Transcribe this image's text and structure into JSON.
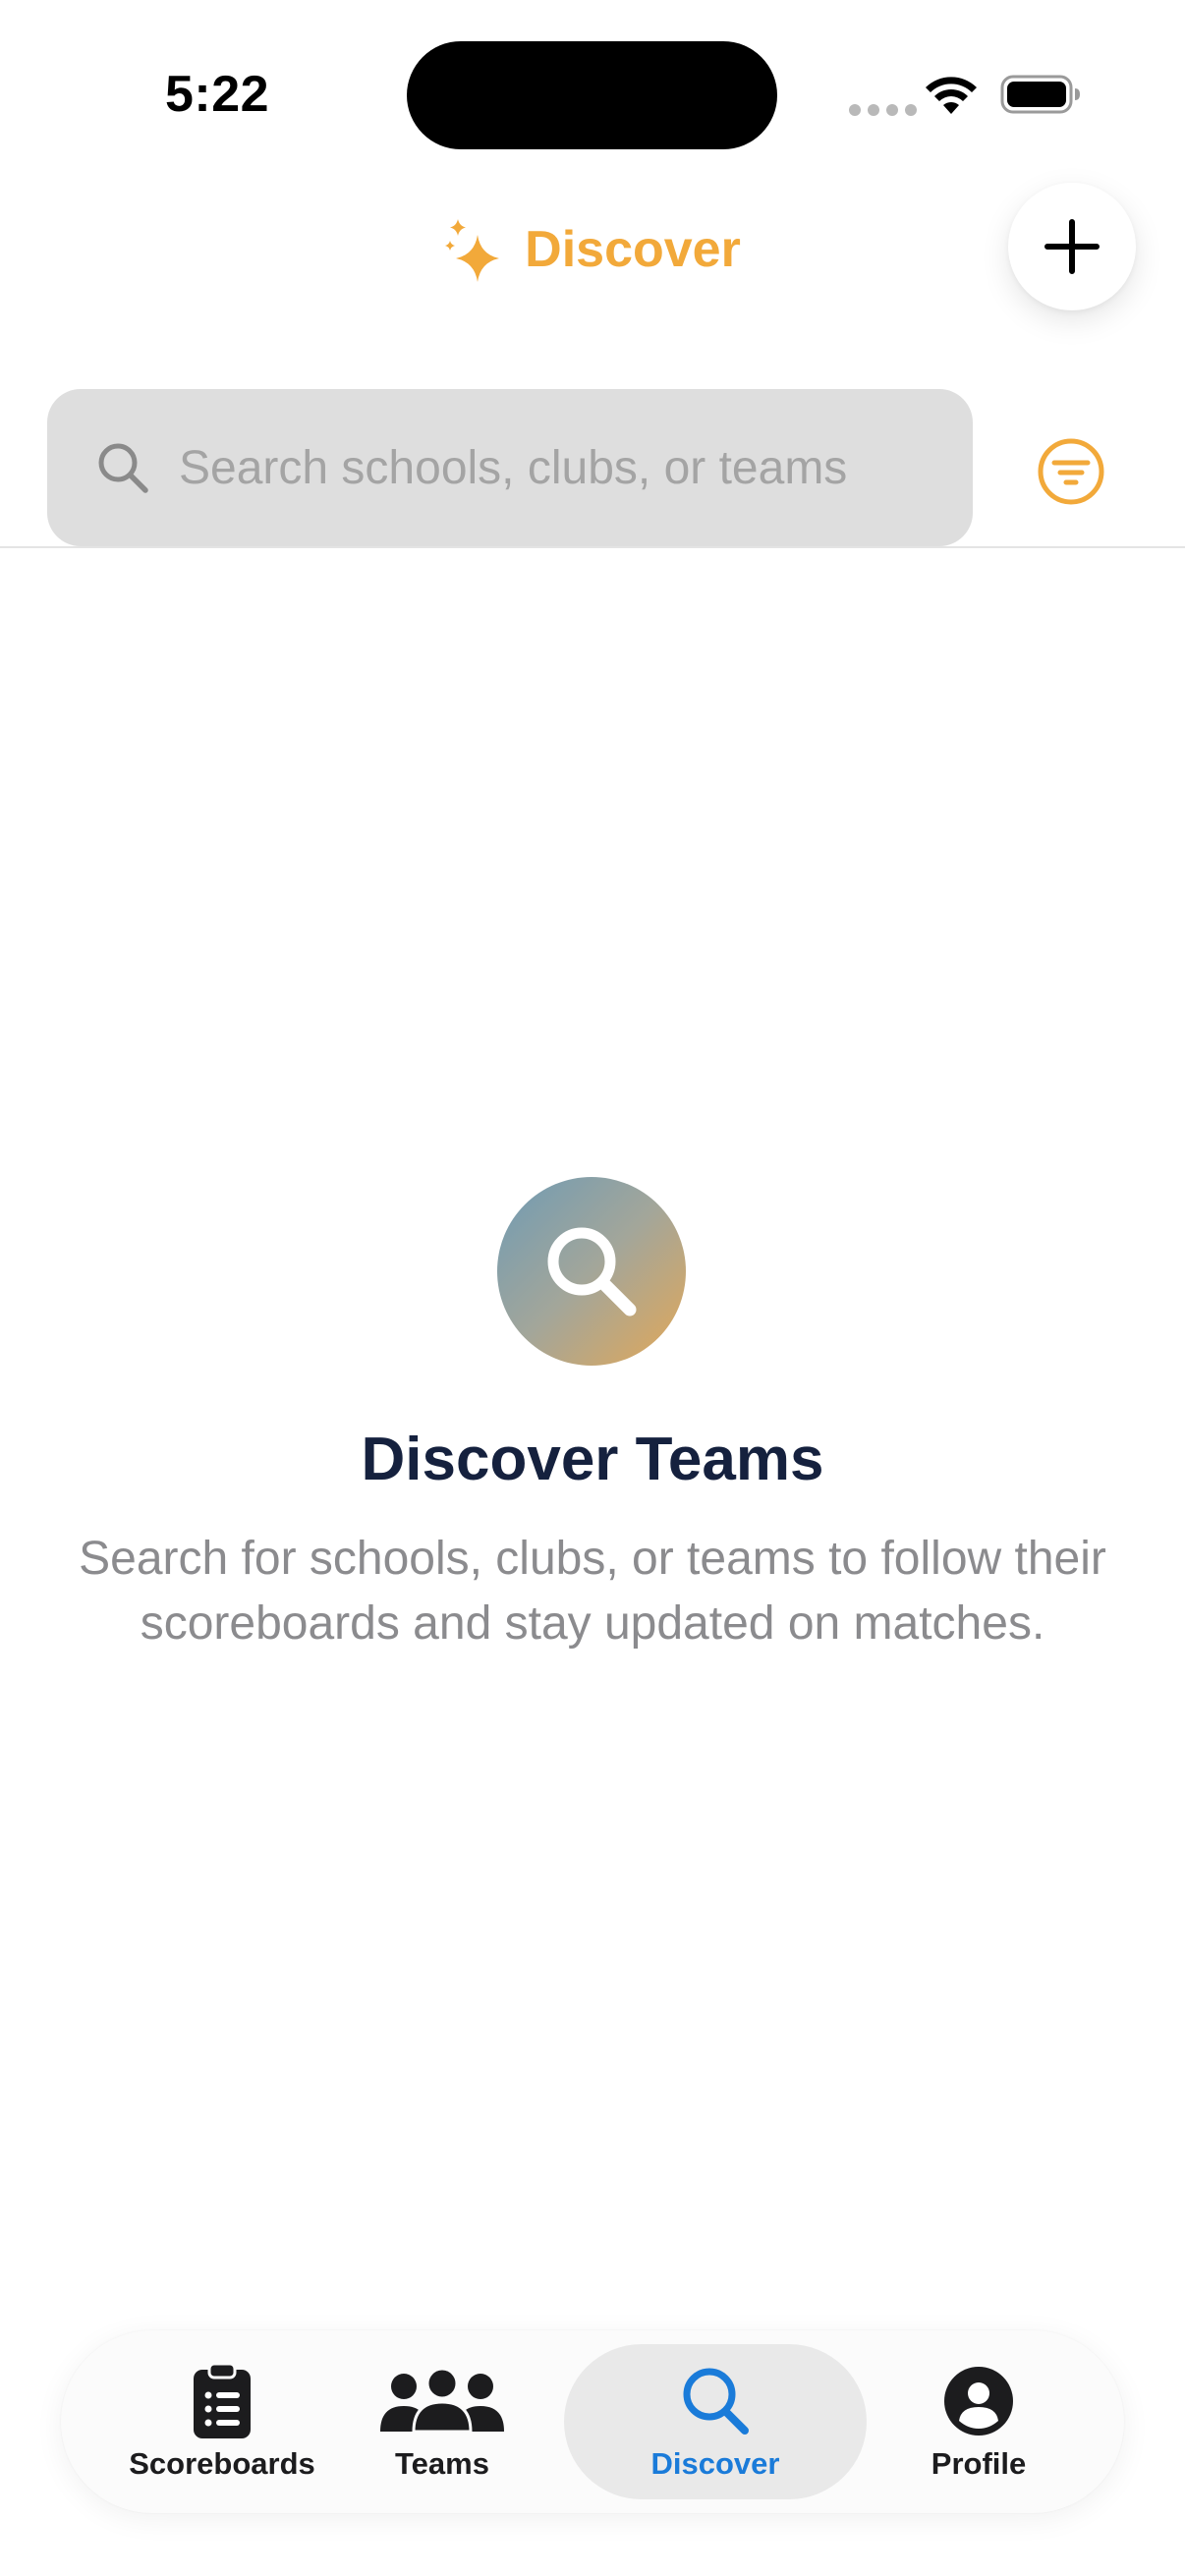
{
  "status_bar": {
    "time": "5:22"
  },
  "header": {
    "title": "Discover",
    "title_icon": "sparkles-icon",
    "add_icon": "plus-icon"
  },
  "search": {
    "placeholder": "Search schools, clubs, or teams",
    "value": "",
    "icon": "search-icon",
    "filter_icon": "filter-icon"
  },
  "empty_state": {
    "icon": "magnifying-glass-icon",
    "title": "Discover Teams",
    "description": "Search for schools, clubs, or teams to follow their scoreboards and stay updated on matches."
  },
  "tab_bar": {
    "active": "Discover",
    "items": [
      {
        "label": "Scoreboards",
        "icon": "clipboard-list-icon"
      },
      {
        "label": "Teams",
        "icon": "people-group-icon"
      },
      {
        "label": "Discover",
        "icon": "search-icon"
      },
      {
        "label": "Profile",
        "icon": "person-circle-icon"
      }
    ]
  },
  "colors": {
    "accent": "#F2A93A",
    "active_tab": "#1A7BD9",
    "title_text": "#15213E",
    "secondary_text": "#8B8B8E",
    "search_bg": "#DEDEDE"
  }
}
